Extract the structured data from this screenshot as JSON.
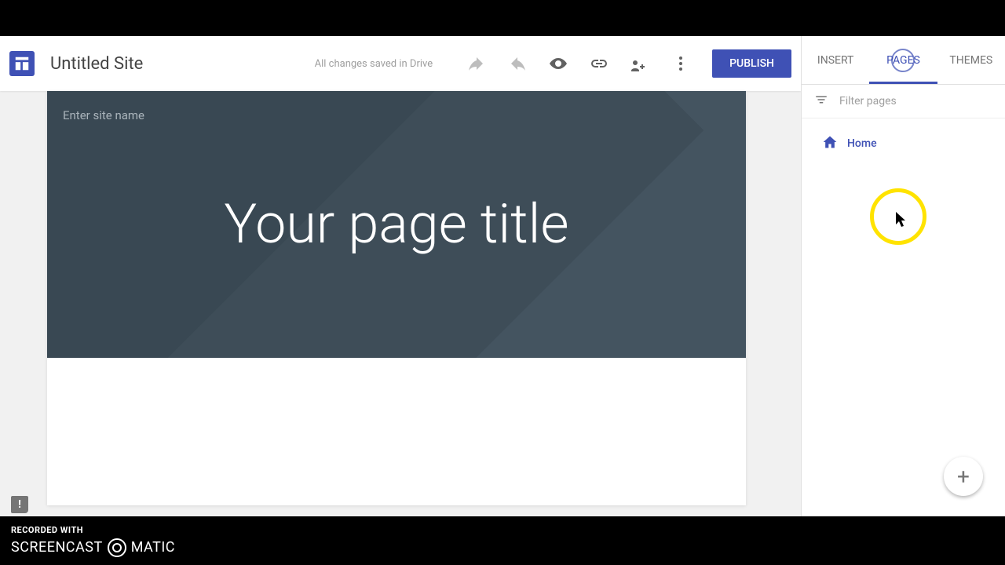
{
  "header": {
    "site_title": "Untitled Site",
    "status": "All changes saved in Drive",
    "publish_label": "PUBLISH"
  },
  "sidebar": {
    "tabs": {
      "insert": "INSERT",
      "pages": "PAGES",
      "themes": "THEMES"
    },
    "filter_placeholder": "Filter pages",
    "pages": [
      {
        "label": "Home"
      }
    ],
    "fab_glyph": "+"
  },
  "canvas": {
    "site_name_placeholder": "Enter site name",
    "page_title": "Your page title"
  },
  "watermark": {
    "recorded_with": "RECORDED WITH",
    "screencast": "SCREENCAST",
    "matic": "MATIC"
  }
}
